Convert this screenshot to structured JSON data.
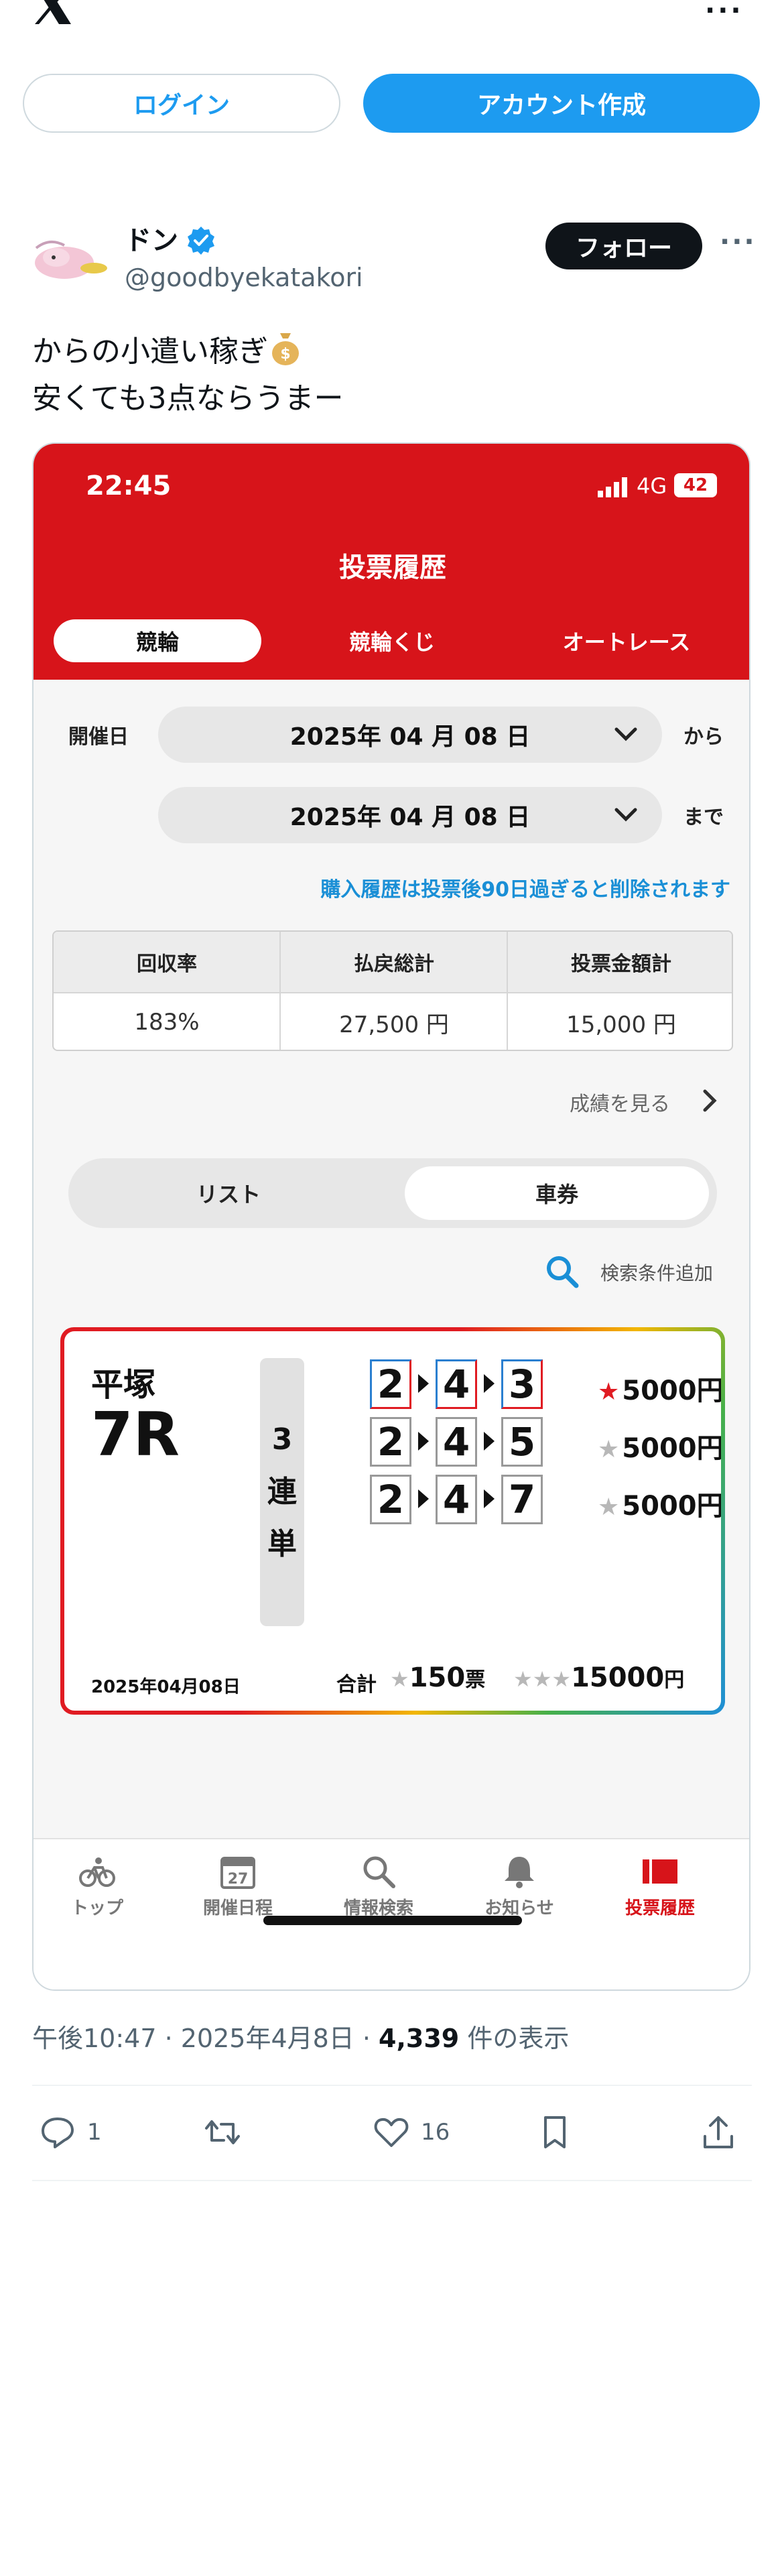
{
  "header": {
    "login_label": "ログイン",
    "signup_label": "アカウント作成"
  },
  "post": {
    "author_name": "ドン",
    "author_handle": "@goodbyekatakori",
    "follow_label": "フォロー",
    "text_line1": "からの小遣い稼ぎ",
    "text_line2": "安くても3点ならうまー",
    "meta_time": "午後10:47 · 2025年4月8日 · ",
    "views_count": "4,339",
    "views_suffix": " 件の表示",
    "replies": "1",
    "likes": "16"
  },
  "phone": {
    "status_time": "22:45",
    "network": "4G",
    "battery": "42",
    "title": "投票履歴",
    "tabs": [
      "競輪",
      "競輪くじ",
      "オートレース"
    ],
    "date_label": "開催日",
    "date_from": "2025年 04 月 08 日",
    "from_suffix": "から",
    "date_to": "2025年 04 月 08 日",
    "to_suffix": "まで",
    "notice": "購入履歴は投票後90日過ぎると削除されます",
    "table": {
      "headers": [
        "回収率",
        "払戻総計",
        "投票金額計"
      ],
      "values": [
        "183%",
        "27,500 円",
        "15,000 円"
      ]
    },
    "results_link": "成績を見る",
    "segments": [
      "リスト",
      "車券"
    ],
    "search_add": "検索条件追加",
    "ticket": {
      "venue": "平塚",
      "race": "7R",
      "bet_type": "3連単",
      "bets": [
        {
          "numbers": [
            "2",
            "4",
            "3"
          ],
          "amount": "5000円",
          "hit": true
        },
        {
          "numbers": [
            "2",
            "4",
            "5"
          ],
          "amount": "5000円",
          "hit": false
        },
        {
          "numbers": [
            "2",
            "4",
            "7"
          ],
          "amount": "5000円",
          "hit": false
        }
      ],
      "date": "2025年04月08日",
      "total_label": "合計",
      "total_count": "150",
      "total_count_unit": "票",
      "total_amount": "15000",
      "total_amount_unit": "円"
    },
    "nav": [
      "トップ",
      "開催日程",
      "情報検索",
      "お知らせ",
      "投票履歴"
    ]
  },
  "icons": {
    "top_bar": [
      "x-logo-icon",
      "more-icon"
    ],
    "actions": [
      "reply-icon",
      "retweet-icon",
      "like-icon",
      "bookmark-icon",
      "share-icon"
    ]
  },
  "colors": {
    "accent_blue": "#1d9bf0",
    "app_red": "#d7141a"
  }
}
